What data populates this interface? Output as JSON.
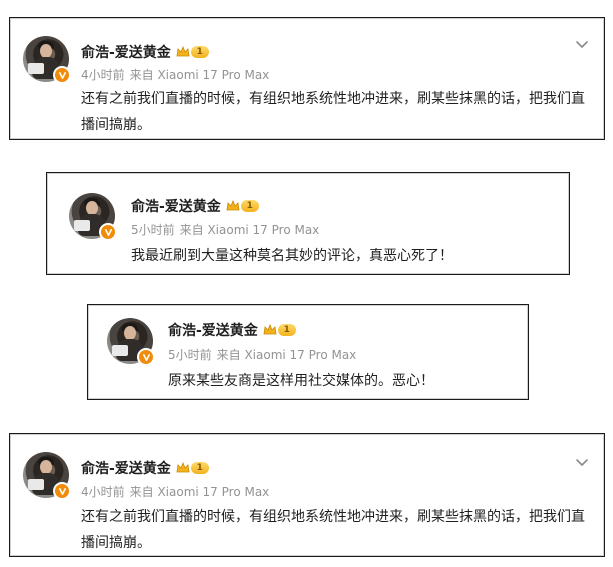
{
  "colors": {
    "badge_orange": "#f08c0a",
    "meta_gray": "#939393",
    "text": "#1f1f1f",
    "level_gold": "#f3b21c"
  },
  "icons": {
    "verified": "v-badge-icon",
    "crown": "crown-icon",
    "more": "chevron-down-icon"
  },
  "posts": [
    {
      "user": "俞浩-爱送黄金",
      "level": "1",
      "time": "4小时前",
      "source": "来自 Xiaomi 17 Pro Max",
      "text": "还有之前我们直播的时候，有组织地系统性地冲进来，刷某些抹黑的话，把我们直播间搞崩。"
    },
    {
      "user": "俞浩-爱送黄金",
      "level": "1",
      "time": "5小时前",
      "source": "来自 Xiaomi 17 Pro Max",
      "text": "我最近刷到大量这种莫名其妙的评论，真恶心死了！"
    },
    {
      "user": "俞浩-爱送黄金",
      "level": "1",
      "time": "5小时前",
      "source": "来自 Xiaomi 17 Pro Max",
      "text": "原来某些友商是这样用社交媒体的。恶心！"
    },
    {
      "user": "俞浩-爱送黄金",
      "level": "1",
      "time": "4小时前",
      "source": "来自 Xiaomi 17 Pro Max",
      "text": "还有之前我们直播的时候，有组织地系统性地冲进来，刷某些抹黑的话，把我们直播间搞崩。"
    }
  ]
}
